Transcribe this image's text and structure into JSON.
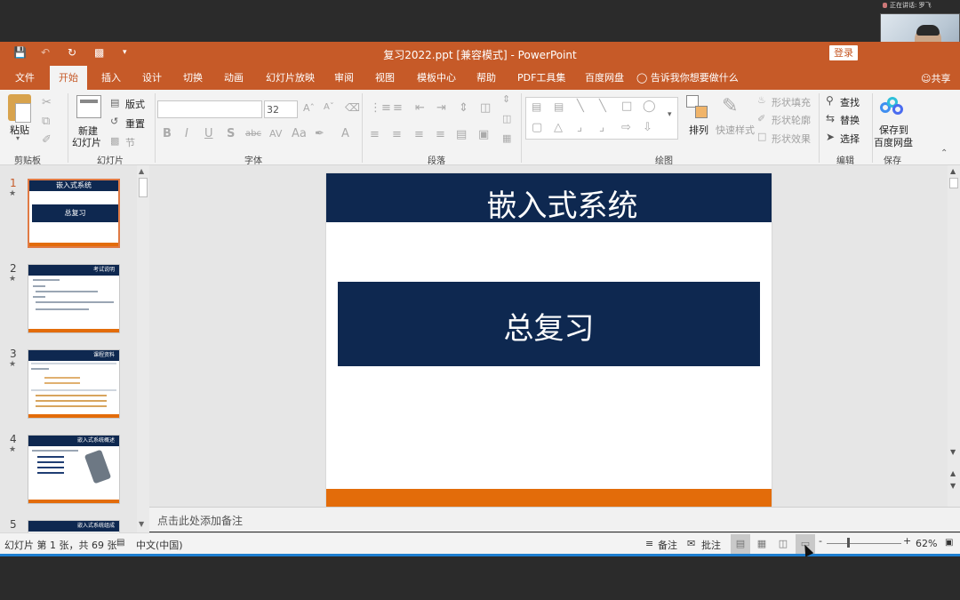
{
  "meeting": {
    "speaker_label": "正在讲话: 罗飞",
    "video_name": "罗飞"
  },
  "titlebar": {
    "title": "复习2022.ppt [兼容模式]  -  PowerPoint",
    "login": "登录"
  },
  "tabs": [
    "文件",
    "开始",
    "插入",
    "设计",
    "切换",
    "动画",
    "幻灯片放映",
    "审阅",
    "视图",
    "模板中心",
    "帮助",
    "PDF工具集",
    "百度网盘"
  ],
  "tell_me": "告诉我你想要做什么",
  "share": "共享",
  "ribbon": {
    "clipboard": {
      "paste": "粘贴",
      "label": "剪贴板"
    },
    "slides": {
      "new_slide_1": "新建",
      "new_slide_2": "幻灯片",
      "layout": "版式",
      "reset": "重置",
      "section": "节",
      "label": "幻灯片"
    },
    "font": {
      "font_name": "",
      "size": "32",
      "label": "字体"
    },
    "paragraph": {
      "label": "段落"
    },
    "drawing": {
      "arrange": "排列",
      "quick_styles": "快速样式",
      "shape_fill": "形状填充",
      "shape_outline": "形状轮廓",
      "shape_effects": "形状效果",
      "label": "绘图"
    },
    "editing": {
      "find": "查找",
      "replace": "替换",
      "select": "选择",
      "label": "编辑"
    },
    "save": {
      "save_to_1": "保存到",
      "save_to_2": "百度网盘",
      "label": "保存"
    }
  },
  "thumbnails": [
    {
      "num": "1",
      "title": "嵌入式系统",
      "box": "总复习"
    },
    {
      "num": "2",
      "title": "考试说明"
    },
    {
      "num": "3",
      "title": "课程资料"
    },
    {
      "num": "4",
      "title": "嵌入式系统概述"
    },
    {
      "num": "5",
      "title": "嵌入式系统组成"
    }
  ],
  "slide": {
    "title": "嵌入式系统",
    "subtitle": "总复习"
  },
  "notes_placeholder": "点击此处添加备注",
  "status": {
    "slide_info": "幻灯片 第 1 张，共 69 张",
    "language": "中文(中国)",
    "notes": "备注",
    "comments": "批注",
    "zoom": "62%"
  },
  "colors": {
    "accent": "#c65a28",
    "slide_navy": "#0e2850",
    "slide_orange": "#e36c0a"
  }
}
